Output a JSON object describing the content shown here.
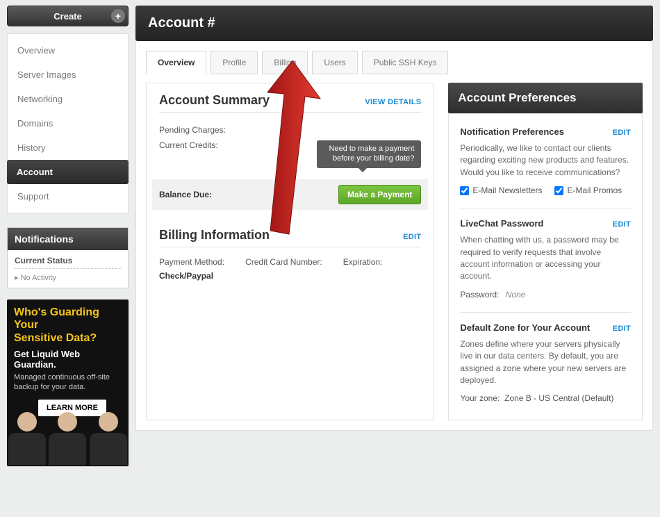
{
  "sidebar": {
    "create_label": "Create",
    "items": [
      "Overview",
      "Server Images",
      "Networking",
      "Domains",
      "History",
      "Account",
      "Support"
    ],
    "active_index": 5
  },
  "notifications": {
    "panel_title": "Notifications",
    "status_label": "Current Status",
    "activity": "No Activity"
  },
  "promo": {
    "headline1": "Who's Guarding Your",
    "headline2": "Sensitive Data?",
    "sub": "Get Liquid Web Guardian.",
    "desc": "Managed continuous off-site backup for your data.",
    "button": "LEARN MORE"
  },
  "header": {
    "title": "Account #"
  },
  "tabs": [
    "Overview",
    "Profile",
    "Billing",
    "Users",
    "Public SSH Keys"
  ],
  "active_tab_index": 0,
  "summary": {
    "title": "Account Summary",
    "view_details": "VIEW DETAILS",
    "rows": {
      "pending": "Pending Charges:",
      "credits": "Current Credits:",
      "balance": "Balance Due:"
    },
    "tooltip": "Need to make a payment before your billing date?",
    "pay_button": "Make a Payment"
  },
  "billing": {
    "title": "Billing Information",
    "edit": "EDIT",
    "cols": {
      "method_label": "Payment Method:",
      "method_value": "Check/Paypal",
      "card_label": "Credit Card Number:",
      "exp_label": "Expiration:"
    }
  },
  "prefs": {
    "panel_title": "Account Preferences",
    "notif": {
      "title": "Notification Preferences",
      "edit": "EDIT",
      "desc": "Periodically, we like to contact our clients regarding exciting new products and features. Would you like to receive communications?",
      "check1": "E-Mail Newsletters",
      "check2": "E-Mail Promos"
    },
    "livechat": {
      "title": "LiveChat Password",
      "edit": "EDIT",
      "desc": "When chatting with us, a password may be required to verify requests that involve account information or accessing your account.",
      "pwd_label": "Password:",
      "pwd_value": "None"
    },
    "zone": {
      "title": "Default Zone for Your Account",
      "edit": "EDIT",
      "desc": "Zones define where your servers physically live in our data centers. By default, you are assigned a zone where your new servers are deployed.",
      "zone_label": "Your zone:",
      "zone_value": "Zone B - US Central (Default)"
    }
  }
}
